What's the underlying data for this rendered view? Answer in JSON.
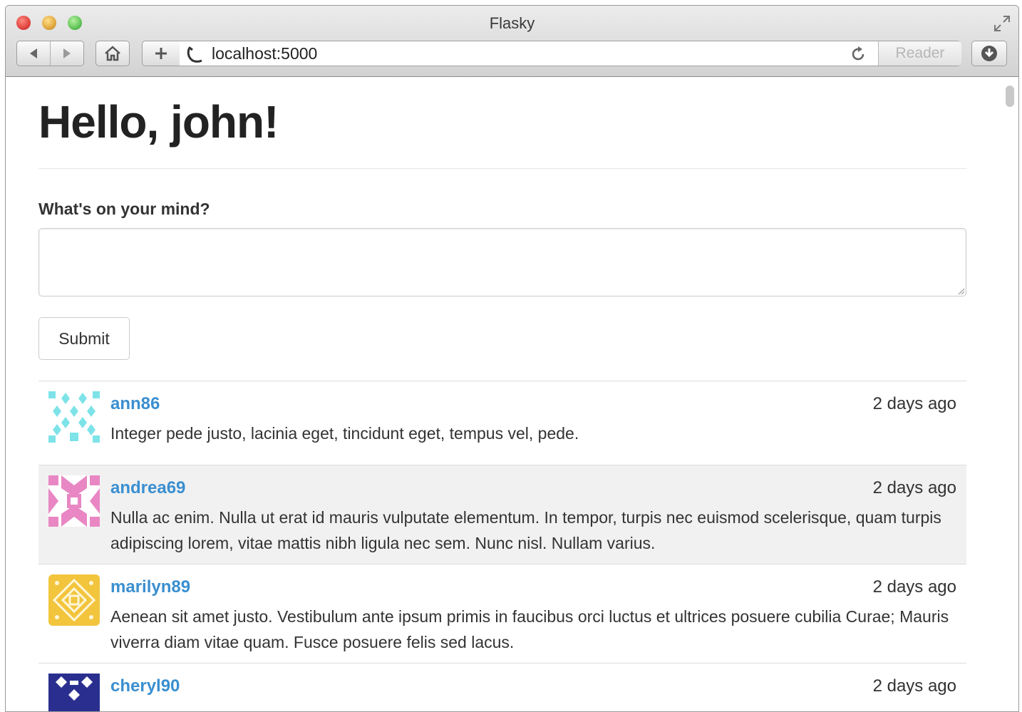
{
  "browser": {
    "window_title": "Flasky",
    "url": "localhost:5000",
    "reader_label": "Reader"
  },
  "page": {
    "heading": "Hello, john!",
    "form_label": "What's on your mind?",
    "textarea_value": "",
    "submit_label": "Submit"
  },
  "posts": [
    {
      "author": "ann86",
      "date": "2 days ago",
      "body": "Integer pede justo, lacinia eget, tincidunt eget, tempus vel, pede.",
      "avatar_color": "#7de3e8"
    },
    {
      "author": "andrea69",
      "date": "2 days ago",
      "body": "Nulla ac enim. Nulla ut erat id mauris vulputate elementum. In tempor, turpis nec euismod scelerisque, quam turpis adipiscing lorem, vitae mattis nibh ligula nec sem. Nunc nisl. Nullam varius.",
      "avatar_color": "#e887c3"
    },
    {
      "author": "marilyn89",
      "date": "2 days ago",
      "body": "Aenean sit amet justo. Vestibulum ante ipsum primis in faucibus orci luctus et ultrices posuere cubilia Curae; Mauris viverra diam vitae quam. Fusce posuere felis sed lacus.",
      "avatar_color": "#f2c53d"
    },
    {
      "author": "cheryl90",
      "date": "2 days ago",
      "body": "",
      "avatar_color": "#2a2f8f"
    }
  ],
  "colors": {
    "link": "#3a8fd0",
    "highlight_row": "#f1f1f1"
  }
}
